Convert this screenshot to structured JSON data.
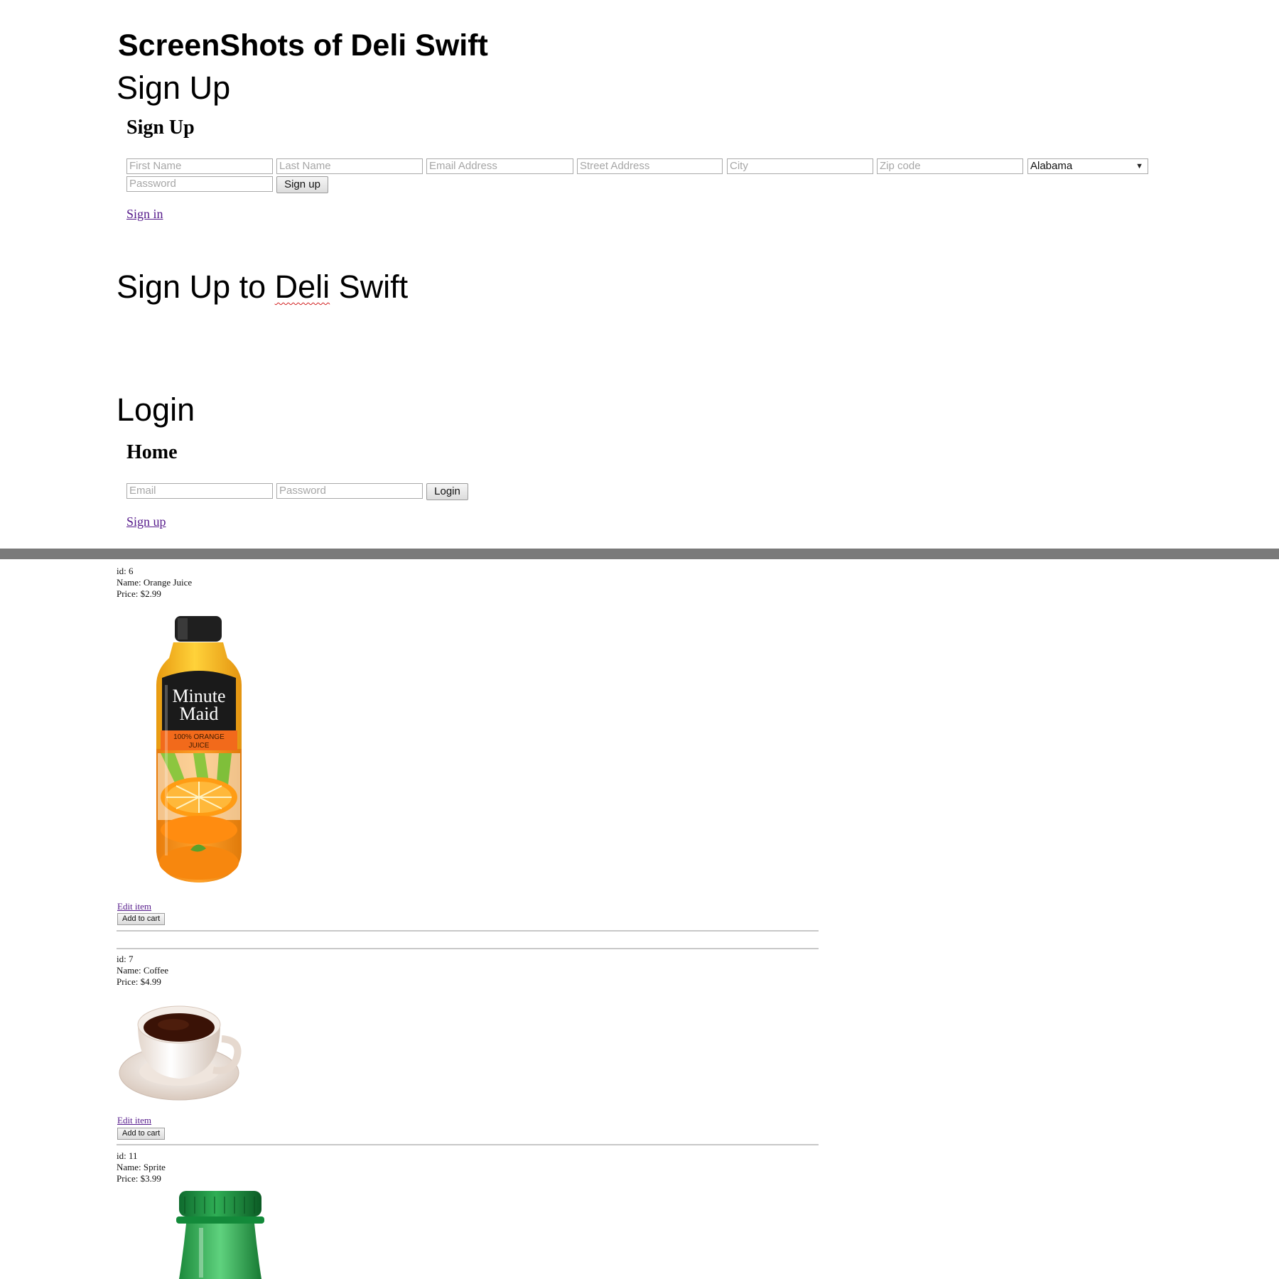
{
  "title": "ScreenShots of Deli Swift",
  "signup_section": {
    "caption": "Sign Up",
    "form_heading": "Sign Up",
    "placeholders": {
      "first_name": "First Name",
      "last_name": "Last Name",
      "email": "Email Address",
      "street": "Street Address",
      "city": "City",
      "zip": "Zip code",
      "password": "Password"
    },
    "state_selected": "Alabama",
    "submit_label": "Sign up",
    "link": "Sign in"
  },
  "signup_caption_2": {
    "prefix": "Sign Up to ",
    "word": "Deli",
    "suffix": " Swift"
  },
  "login_section": {
    "caption": "Login",
    "form_heading": "Home",
    "placeholders": {
      "email": "Email",
      "password": "Password"
    },
    "submit_label": "Login",
    "link": "Sign up"
  },
  "products": [
    {
      "id_text": "id: 6",
      "name_text": "Name: Orange Juice",
      "price_text": "Price: $2.99",
      "image_icon": "orange-juice-bottle-icon",
      "label_lines": [
        "Minute",
        "Maid",
        "100% ORANGE",
        "JUICE"
      ],
      "edit_label": "Edit item",
      "cart_label": "Add to cart"
    },
    {
      "id_text": "id: 7",
      "name_text": "Name: Coffee",
      "price_text": "Price: $4.99",
      "image_icon": "coffee-cup-icon",
      "edit_label": "Edit item",
      "cart_label": "Add to cart"
    },
    {
      "id_text": "id: 11",
      "name_text": "Name: Sprite",
      "price_text": "Price: $3.99",
      "image_icon": "sprite-bottle-icon"
    }
  ],
  "colors": {
    "link": "#551a8b",
    "divider": "#7a7a7a",
    "spellcheck": "#d21e1e"
  }
}
